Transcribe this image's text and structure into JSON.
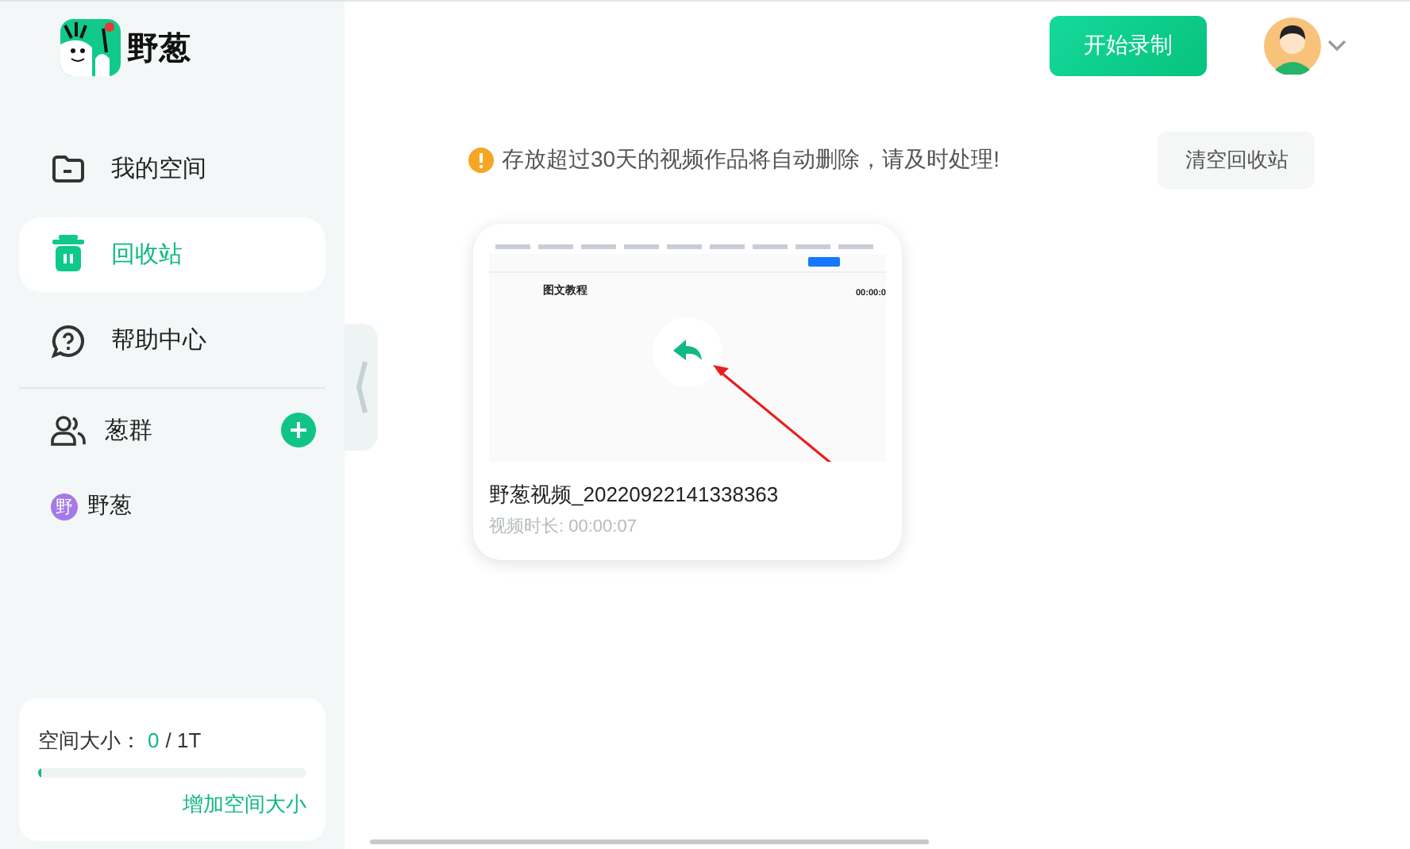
{
  "logo": {
    "text": "野葱"
  },
  "nav": [
    {
      "label": "我的空间",
      "kind": "folder",
      "selected": false
    },
    {
      "label": "回收站",
      "kind": "trash",
      "selected": true
    },
    {
      "label": "帮助中心",
      "kind": "help",
      "selected": false
    }
  ],
  "groups": {
    "label": "葱群",
    "items": [
      {
        "avatar": "野",
        "name": "野葱",
        "color": "#a579e8"
      }
    ]
  },
  "storage": {
    "label": "空间大小：",
    "used": "0",
    "total": "/ 1T",
    "level": 0.01,
    "link": "增加空间大小"
  },
  "header": {
    "record_button": "开始录制"
  },
  "notice": {
    "text": "存放超过30天的视频作品将自动删除，请及时处理!",
    "button": "清空回收站"
  },
  "videos": [
    {
      "title": "野葱视频_20220922141338363",
      "duration": "视频时长: 00:00:07",
      "thumbnail": {
        "heading": "图文教程",
        "time": "00:00:0"
      }
    }
  ]
}
